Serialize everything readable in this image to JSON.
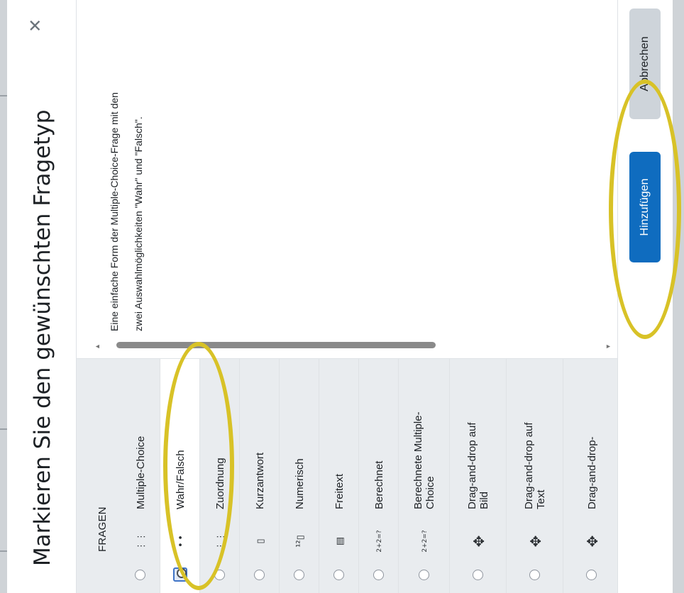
{
  "dialog": {
    "title": "Markieren Sie den gewünschten Fragetyp",
    "close_icon": "close-icon"
  },
  "sidebar": {
    "heading": "FRAGEN",
    "items": [
      {
        "label": "Multiple-Choice",
        "icon": "⋮⋮",
        "selected": false
      },
      {
        "label": "Wahr/Falsch",
        "icon": "• •",
        "selected": true
      },
      {
        "label": "Zuordnung",
        "icon": "⋮⋮",
        "selected": false
      },
      {
        "label": "Kurzantwort",
        "icon": "▯",
        "selected": false
      },
      {
        "label": "Numerisch",
        "icon": "¹²▯",
        "selected": false
      },
      {
        "label": "Freitext",
        "icon": "▤",
        "selected": false
      },
      {
        "label": "Berechnet",
        "icon": "2+2=?",
        "selected": false
      },
      {
        "label": "Berechnete Multiple-Choice",
        "icon": "2+2=?",
        "selected": false
      },
      {
        "label": "Drag-and-drop auf Bild",
        "icon": "✥",
        "selected": false
      },
      {
        "label": "Drag-and-drop auf Text",
        "icon": "✥",
        "selected": false
      },
      {
        "label": "Drag-and-drop-",
        "icon": "✥",
        "selected": false
      }
    ]
  },
  "description": {
    "text": "Eine einfache Form der Multiple-Choice-Frage mit den zwei Auswahlmöglichkeiten \"Wahr\" und \"Falsch\"."
  },
  "footer": {
    "add_label": "Hinzufügen",
    "cancel_label": "Abbrechen"
  },
  "colors": {
    "primary": "#0f6cbf",
    "secondary": "#ced4da",
    "sidebar_bg": "#e9ecef",
    "highlight": "#d8c227"
  }
}
